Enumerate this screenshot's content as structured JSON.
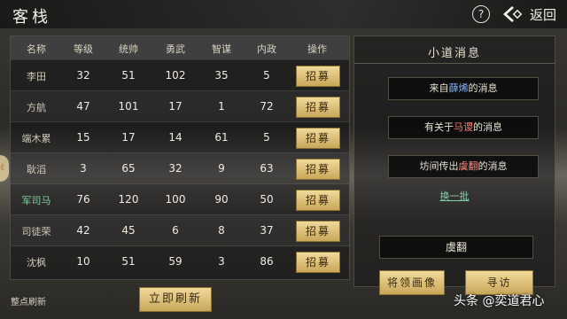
{
  "header": {
    "title": "客栈",
    "help": "?",
    "back_label": "返回"
  },
  "table": {
    "headers": [
      "名称",
      "等级",
      "统帅",
      "勇武",
      "智谋",
      "内政",
      "操作"
    ],
    "recruit_label": "招募",
    "rows": [
      {
        "name": "李田",
        "level": "32",
        "command": "51",
        "valor": "102",
        "wisdom": "35",
        "politics": "5",
        "highlight": false
      },
      {
        "name": "方航",
        "level": "47",
        "command": "101",
        "valor": "17",
        "wisdom": "1",
        "politics": "72",
        "highlight": false
      },
      {
        "name": "端木累",
        "level": "15",
        "command": "17",
        "valor": "14",
        "wisdom": "61",
        "politics": "5",
        "highlight": false
      },
      {
        "name": "耿滔",
        "level": "3",
        "command": "65",
        "valor": "32",
        "wisdom": "9",
        "politics": "63",
        "highlight": false
      },
      {
        "name": "军司马",
        "level": "76",
        "command": "120",
        "valor": "100",
        "wisdom": "90",
        "politics": "50",
        "highlight": true
      },
      {
        "name": "司徒荣",
        "level": "42",
        "command": "45",
        "valor": "6",
        "wisdom": "8",
        "politics": "37",
        "highlight": false
      },
      {
        "name": "沈枫",
        "level": "10",
        "command": "51",
        "valor": "59",
        "wisdom": "3",
        "politics": "86",
        "highlight": false
      }
    ]
  },
  "footer": {
    "label": "整点刷新",
    "refresh_button": "立即刷新"
  },
  "news": {
    "title": "小道消息",
    "messages": [
      {
        "prefix": "来自",
        "name": "薛烯",
        "suffix": "的消息",
        "color": "#8ab4ff"
      },
      {
        "prefix": "有关于",
        "name": "马谡",
        "suffix": "的消息",
        "color": "#ff7a6a"
      },
      {
        "prefix": "坊间传出",
        "name": "虞翻",
        "suffix": "的消息",
        "color": "#ff8a7a"
      }
    ],
    "swap_link": "换一批",
    "selected_name": "虞翻",
    "portrait_button": "将领画像",
    "visit_button": "寻访"
  },
  "watermark": "头条 @奕道君心"
}
